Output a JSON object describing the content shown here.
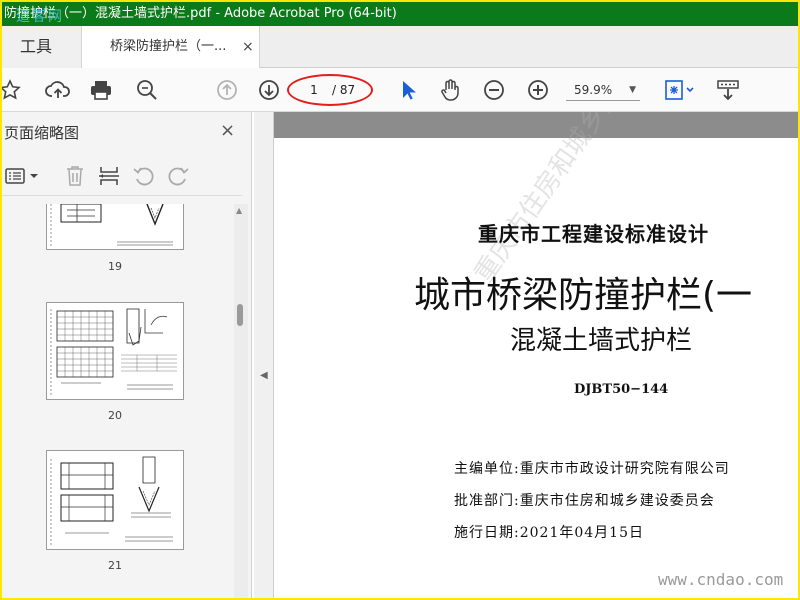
{
  "window": {
    "title": "防撞护栏（一）混凝土墙式护栏.pdf - Adobe Acrobat Pro (64-bit)",
    "watermark": "道客网"
  },
  "tabs": {
    "tools_label": "工具",
    "doc_label": "桥梁防撞护栏（一...",
    "close_glyph": "×"
  },
  "toolbar": {
    "page_current": "1",
    "page_total": "/ 87",
    "zoom": "59.9%",
    "icons": [
      "star-icon",
      "cloud-upload-icon",
      "print-icon",
      "zoom-search-icon",
      "page-up-icon",
      "page-down-icon",
      "cursor-icon",
      "hand-icon",
      "zoom-out-icon",
      "zoom-in-icon",
      "fit-page-icon",
      "scroll-mode-icon"
    ]
  },
  "sidebar": {
    "title": "页面缩略图",
    "close_glyph": "×",
    "thumbnails": [
      {
        "page": "19"
      },
      {
        "page": "20"
      },
      {
        "page": "21"
      }
    ]
  },
  "document": {
    "line1": "重庆市工程建设标准设计",
    "line2": "城市桥梁防撞护栏(一",
    "line3": "混凝土墙式护栏",
    "code": "DJBT50−144",
    "info1": "主编单位:重庆市市政设计研究院有限公司",
    "info2": "批准部门:重庆市住房和城乡建设委员会",
    "info3": "施行日期:2021年04月15日",
    "stamp": "重庆市住房和城乡建设委员会",
    "site": "www.cndao.com"
  },
  "colors": {
    "titlebar": "#0a7a1a",
    "outer_border": "#ffe600",
    "highlight": "#e41d1d",
    "accent_blue": "#1a5fd6"
  }
}
